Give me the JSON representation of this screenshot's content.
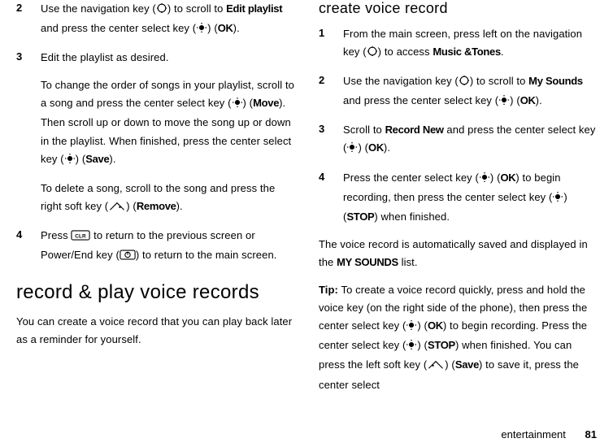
{
  "left": {
    "step2": {
      "num": "2",
      "t1": "Use the navigation key (",
      "t2": ") to scroll to ",
      "bold1": "Edit playlist",
      "t3": " and press the center select key (",
      "t4": ") (",
      "bold2": "OK",
      "t5": ")."
    },
    "step3": {
      "num": "3",
      "t1": "Edit the playlist as desired."
    },
    "p1": {
      "t1": "To change the order of songs in your playlist, scroll to a song and press the center select key (",
      "t2": ") (",
      "bold1": "Move",
      "t3": "). Then scroll up or down to move the song up or down in the playlist. When finished, press the center select key (",
      "t4": ") (",
      "bold2": "Save",
      "t5": ")."
    },
    "p2": {
      "t1": "To delete a song, scroll to the song and press the right soft key (",
      "t2": ") (",
      "bold1": "Remove",
      "t3": ")."
    },
    "step4": {
      "num": "4",
      "t1": "Press ",
      "t2": " to return to the previous screen or Power/End key (",
      "t3": ") to return to the main screen."
    },
    "heading": "record & play voice records",
    "p3": "You can create a voice record that you can play back later as a reminder for yourself."
  },
  "right": {
    "heading": "create voice record",
    "step1": {
      "num": "1",
      "t1": "From the main screen, press left on the navigation key (",
      "t2": ") to access ",
      "bold1": "Music &Tones",
      "t3": "."
    },
    "step2": {
      "num": "2",
      "t1": "Use the navigation key (",
      "t2": ") to scroll to ",
      "bold1": "My Sounds",
      "t3": " and press the center select key (",
      "t4": ") (",
      "bold2": "OK",
      "t5": ")."
    },
    "step3": {
      "num": "3",
      "t1": "Scroll to ",
      "bold1": "Record New",
      "t2": " and press the center select key (",
      "t3": ") (",
      "bold2": "OK",
      "t4": ")."
    },
    "step4": {
      "num": "4",
      "t1": "Press the center select key (",
      "t2": ") (",
      "bold1": "OK",
      "t3": ") to begin recording, then press the center select key (",
      "t4": ") (",
      "bold2": "STOP",
      "t5": ") when finished."
    },
    "p1": {
      "t1": "The voice record is automatically saved and displayed in the ",
      "bold1": "MY SOUNDS",
      "t2": " list."
    },
    "tip": {
      "label": "Tip:",
      "t1": " To create a voice record quickly, press and hold the voice key (on the right side of the phone), then press the center select key (",
      "t2": ") (",
      "bold1": "OK",
      "t3": ") to begin recording. Press the center select key (",
      "t4": ") (",
      "bold2": "STOP",
      "t5": ") when finished. You can press the left soft key (",
      "t6": ") (",
      "bold3": "Save",
      "t7": ") to save it, press the center select"
    }
  },
  "footer": {
    "label": "entertainment",
    "page": "81"
  }
}
